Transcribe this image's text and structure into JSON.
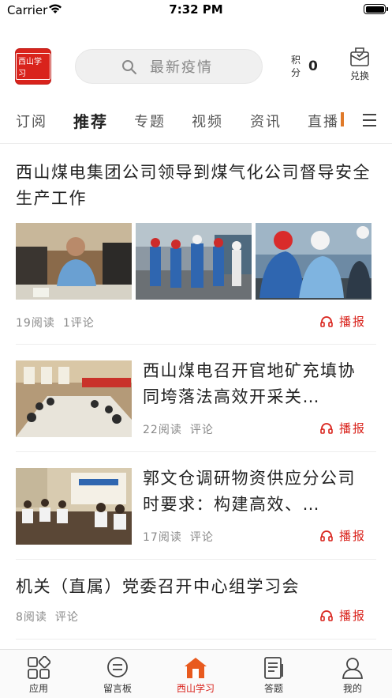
{
  "status_bar": {
    "carrier": "Carrier",
    "time": "7:32 PM"
  },
  "header": {
    "logo_text": "西山学习",
    "search_placeholder": "最新疫情",
    "points_label": "积分",
    "points_value": "0",
    "redeem_label": "兑换"
  },
  "tabs": [
    {
      "label": "订阅"
    },
    {
      "label": "推荐",
      "active": true
    },
    {
      "label": "专题"
    },
    {
      "label": "视频"
    },
    {
      "label": "资讯"
    },
    {
      "label": "直播"
    }
  ],
  "articles": [
    {
      "title": "西山煤电集团公司领导到煤气化公司督导安全生产工作",
      "reads": "19阅读",
      "comments": "1评论",
      "listen_label": "播报"
    },
    {
      "title": "西山煤电召开官地矿充填协同垮落法高效开采关…",
      "reads": "22阅读",
      "comments": "评论",
      "listen_label": "播报"
    },
    {
      "title": "郭文仓调研物资供应分公司时要求：构建高效、…",
      "reads": "17阅读",
      "comments": "评论",
      "listen_label": "播报"
    },
    {
      "title": "机关（直属）党委召开中心组学习会",
      "reads": "8阅读",
      "comments": "评论",
      "listen_label": "播报"
    }
  ],
  "bottom_nav": [
    {
      "label": "应用",
      "icon": "apps-icon"
    },
    {
      "label": "留言板",
      "icon": "message-board-icon"
    },
    {
      "label": "西山学习",
      "icon": "home-icon",
      "active": true
    },
    {
      "label": "答题",
      "icon": "quiz-icon"
    },
    {
      "label": "我的",
      "icon": "profile-icon"
    }
  ],
  "colors": {
    "accent": "#d9231c",
    "text": "#222222",
    "muted": "#888888"
  }
}
